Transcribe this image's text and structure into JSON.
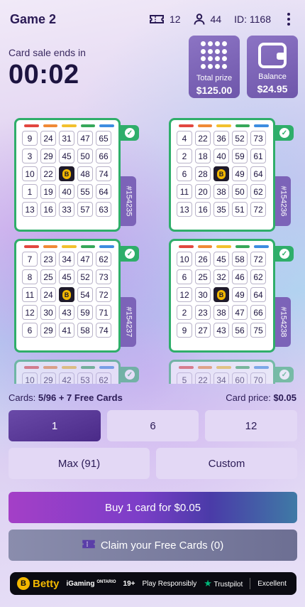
{
  "header": {
    "title": "Game 2",
    "tickets": "12",
    "players": "44",
    "game_id": "ID: 1168"
  },
  "timer": {
    "label": "Card sale ends in",
    "value": "00:02"
  },
  "prize": {
    "label": "Total prize",
    "value": "$125.00"
  },
  "balance": {
    "label": "Balance",
    "value": "$24.95"
  },
  "bar_colors": [
    "#e2473f",
    "#f08a35",
    "#f2c12e",
    "#36a85a",
    "#3d8de0"
  ],
  "cards": [
    {
      "id": "#154235",
      "rows": [
        [
          "9",
          "24",
          "31",
          "47",
          "65"
        ],
        [
          "3",
          "29",
          "45",
          "50",
          "66"
        ],
        [
          "10",
          "22",
          "FREE",
          "48",
          "74"
        ],
        [
          "1",
          "19",
          "40",
          "55",
          "64"
        ],
        [
          "13",
          "16",
          "33",
          "57",
          "63"
        ]
      ]
    },
    {
      "id": "#154236",
      "rows": [
        [
          "4",
          "22",
          "36",
          "52",
          "73"
        ],
        [
          "2",
          "18",
          "40",
          "59",
          "61"
        ],
        [
          "6",
          "28",
          "FREE",
          "49",
          "64"
        ],
        [
          "11",
          "20",
          "38",
          "50",
          "62"
        ],
        [
          "13",
          "16",
          "35",
          "51",
          "72"
        ]
      ]
    },
    {
      "id": "#154237",
      "rows": [
        [
          "7",
          "23",
          "34",
          "47",
          "62"
        ],
        [
          "8",
          "25",
          "45",
          "52",
          "73"
        ],
        [
          "11",
          "24",
          "FREE",
          "54",
          "72"
        ],
        [
          "12",
          "30",
          "43",
          "59",
          "71"
        ],
        [
          "6",
          "29",
          "41",
          "58",
          "74"
        ]
      ]
    },
    {
      "id": "#154238",
      "rows": [
        [
          "10",
          "26",
          "45",
          "58",
          "72"
        ],
        [
          "6",
          "25",
          "32",
          "46",
          "62"
        ],
        [
          "12",
          "30",
          "FREE",
          "49",
          "64"
        ],
        [
          "2",
          "23",
          "38",
          "47",
          "66"
        ],
        [
          "9",
          "27",
          "43",
          "56",
          "75"
        ]
      ]
    },
    {
      "id": "",
      "rows": [
        [
          "10",
          "29",
          "42",
          "53",
          "62"
        ]
      ]
    },
    {
      "id": "",
      "rows": [
        [
          "5",
          "22",
          "34",
          "60",
          "70"
        ]
      ]
    }
  ],
  "info": {
    "cards_prefix": "Cards:",
    "cards_value": "5/96 + 7 Free Cards",
    "price_label": "Card price:",
    "price_value": "$0.05"
  },
  "quantity": {
    "q1": "1",
    "q6": "6",
    "q12": "12",
    "max": "Max (91)",
    "custom": "Custom"
  },
  "buy_label": "Buy 1 card for $0.05",
  "claim_label": "Claim your Free Cards (0)",
  "footer": {
    "brand": "Betty",
    "igaming": "iGaming",
    "igaming_sub": "ONTARIO",
    "age": "19+",
    "responsible": "Play Responsibly",
    "trustpilot": "Trustpilot",
    "rating": "Excellent"
  }
}
